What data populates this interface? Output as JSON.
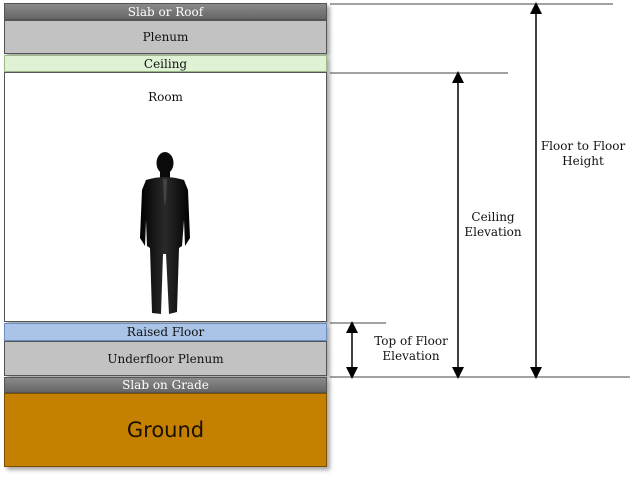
{
  "layers": {
    "slab_roof": "Slab or Roof",
    "plenum": "Plenum",
    "ceiling": "Ceiling",
    "room": "Room",
    "raised_floor": "Raised Floor",
    "underfloor_plenum": "Underfloor Plenum",
    "slab_on_grade": "Slab on Grade",
    "ground": "Ground"
  },
  "dimensions": {
    "top_of_floor_line1": "Top of Floor",
    "top_of_floor_line2": "Elevation",
    "ceiling_elev_line1": "Ceiling",
    "ceiling_elev_line2": "Elevation",
    "floor_to_floor_line1": "Floor to Floor",
    "floor_to_floor_line2": "Height"
  },
  "colors": {
    "ground": "#c48000",
    "raised_floor": "#a9c4e6",
    "ceiling": "#dff2d4",
    "slab": "#6e6e6e",
    "plenum": "#c2c2c2"
  }
}
